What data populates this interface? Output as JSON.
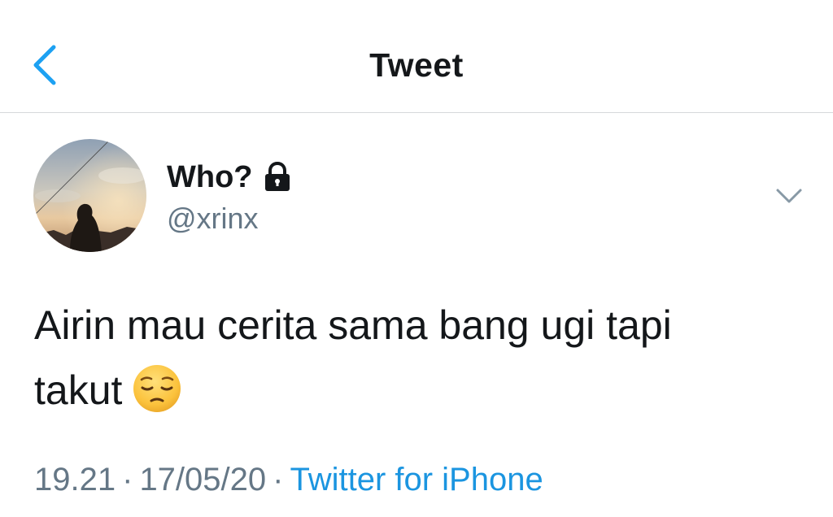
{
  "header": {
    "title": "Tweet",
    "back_icon": "chevron-left-icon",
    "accent_color": "#1da1f2"
  },
  "tweet": {
    "author": {
      "display_name": "Who?",
      "username": "@xrinx",
      "protected": true,
      "lock_icon": "lock-icon"
    },
    "text_line1": "Airin mau cerita sama bang ugi tapi",
    "text_line2": "takut",
    "emoji": "pensive-face-emoji",
    "time": "19.21",
    "separator": "·",
    "date": "17/05/20",
    "source": "Twitter for iPhone",
    "more_icon": "chevron-down-icon"
  }
}
